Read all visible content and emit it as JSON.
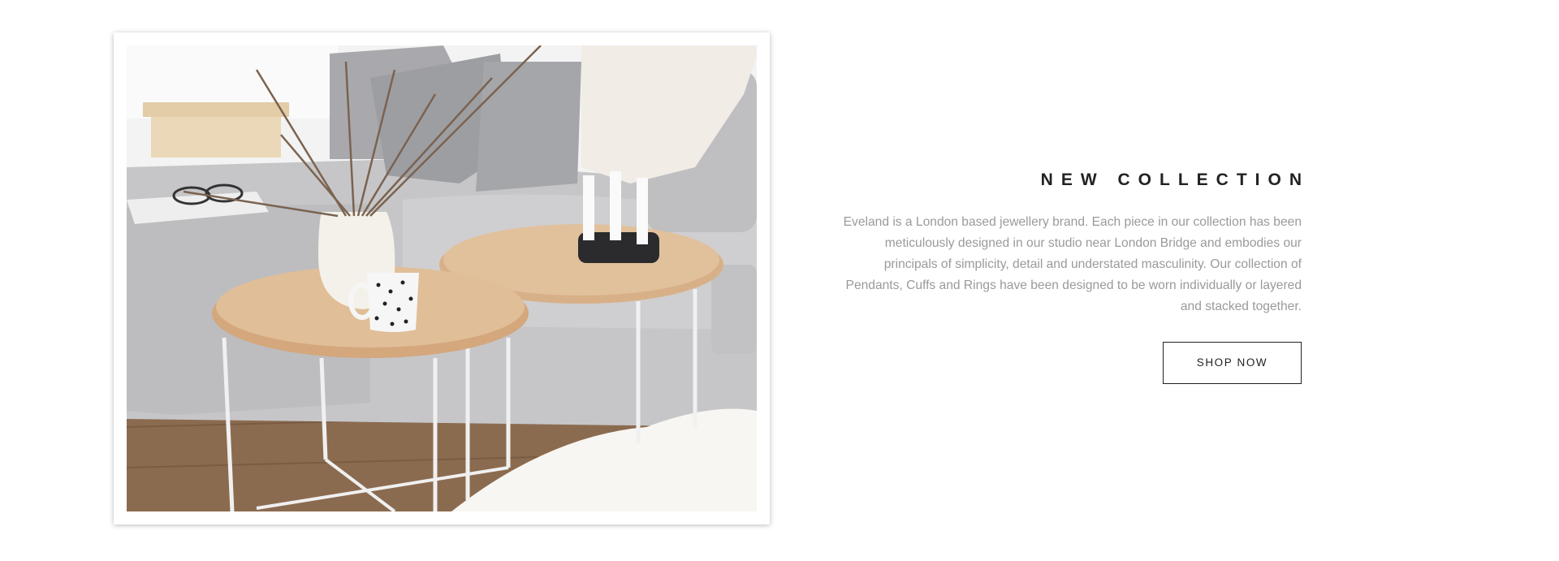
{
  "hero": {
    "title": "NEW COLLECTION",
    "description": "Eveland is a London based jewellery brand. Each piece in our collection has been meticulously designed in our studio near London Bridge and embodies our principals of simplicity, detail and understated masculinity. Our collection of Pendants, Cuffs and Rings have been designed to be worn individually or layered and stacked together.",
    "cta_label": "SHOP NOW"
  },
  "image": {
    "subject": "living room with grey sofa, two round wooden side tables, vase with branches, mug and candles",
    "colors": {
      "wall": "#f4f4f4",
      "sofa": "#c9c9cb",
      "wood_table": "#d9b38c",
      "floor": "#8a6a4e",
      "rug": "#f7f5f2"
    }
  },
  "colors": {
    "title": "#222222",
    "body_text": "#9a9a9a",
    "button_border": "#222222",
    "background": "#ffffff"
  }
}
